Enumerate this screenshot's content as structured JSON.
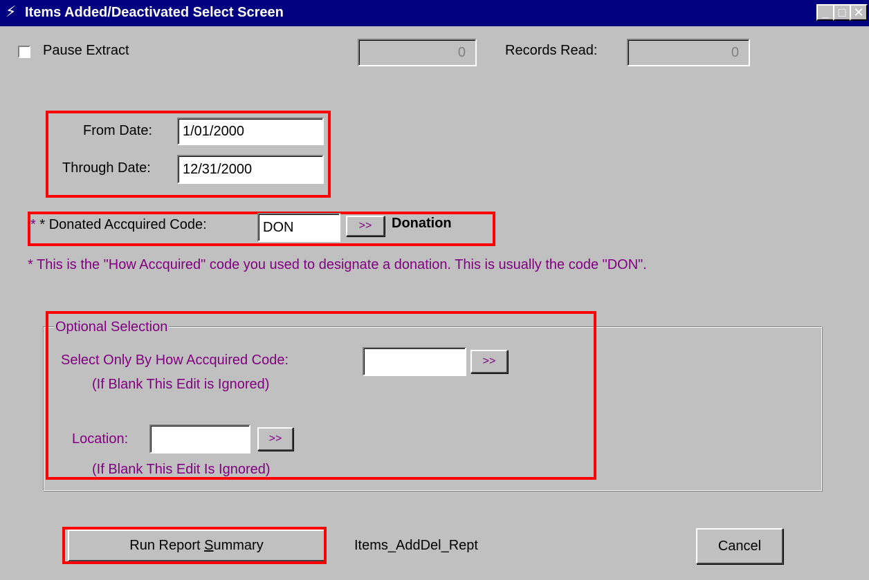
{
  "window": {
    "title": "Items Added/Deactivated  Select Screen",
    "controls": {
      "minimize": "_",
      "maximize": "□",
      "close": "✕"
    }
  },
  "top": {
    "pause_label": "Pause Extract",
    "counter_value": "0",
    "records_read_label": "Records Read:",
    "records_read_value": "0"
  },
  "dates": {
    "from_label": "From Date:",
    "from_value": "1/01/2000",
    "through_label": "Through Date:",
    "through_value": "12/31/2000"
  },
  "donated": {
    "label": "* Donated  Accquired Code:",
    "value": "DON",
    "lookup_label": ">>",
    "description": "Donation",
    "help": "* This is the \"How Accquired\" code you used to designate a donation.  This is usually the code \"DON\"."
  },
  "optional": {
    "legend": "Optional Selection",
    "how_label": "Select Only By How Accquired Code:",
    "how_value": "",
    "how_lookup": ">>",
    "how_note": "(If Blank This Edit is Ignored)",
    "location_label": "Location:",
    "location_value": "",
    "location_lookup": ">>",
    "location_note": "(If Blank This Edit Is Ignored)"
  },
  "footer": {
    "run_prefix": "Run Report ",
    "run_underline": "S",
    "run_suffix": "ummary",
    "report_name": "Items_AddDel_Rept",
    "cancel_label": "Cancel"
  },
  "colors": {
    "titlebar": "#000080",
    "background": "#c0c0c0",
    "highlight": "#ff0000",
    "hint_text": "#800080"
  }
}
